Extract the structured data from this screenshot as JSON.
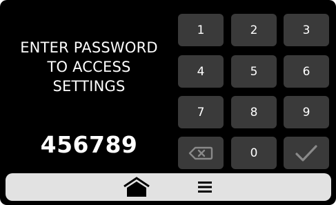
{
  "prompt": {
    "line1": "ENTER PASSWORD",
    "line2": "TO ACCESS",
    "line3": "SETTINGS"
  },
  "entered_value": "456789",
  "keypad": {
    "keys": [
      "1",
      "2",
      "3",
      "4",
      "5",
      "6",
      "7",
      "8",
      "9",
      "0"
    ],
    "backspace_icon": "backspace-icon",
    "confirm_icon": "checkmark-icon"
  },
  "nav": {
    "home_icon": "home-icon",
    "menu_icon": "menu-icon"
  },
  "colors": {
    "screen_bg": "#000000",
    "key_bg": "#3a3a3a",
    "key_text": "#ffffff",
    "nav_bg": "#e2e2e2",
    "icon_muted": "#8a8a8a"
  }
}
